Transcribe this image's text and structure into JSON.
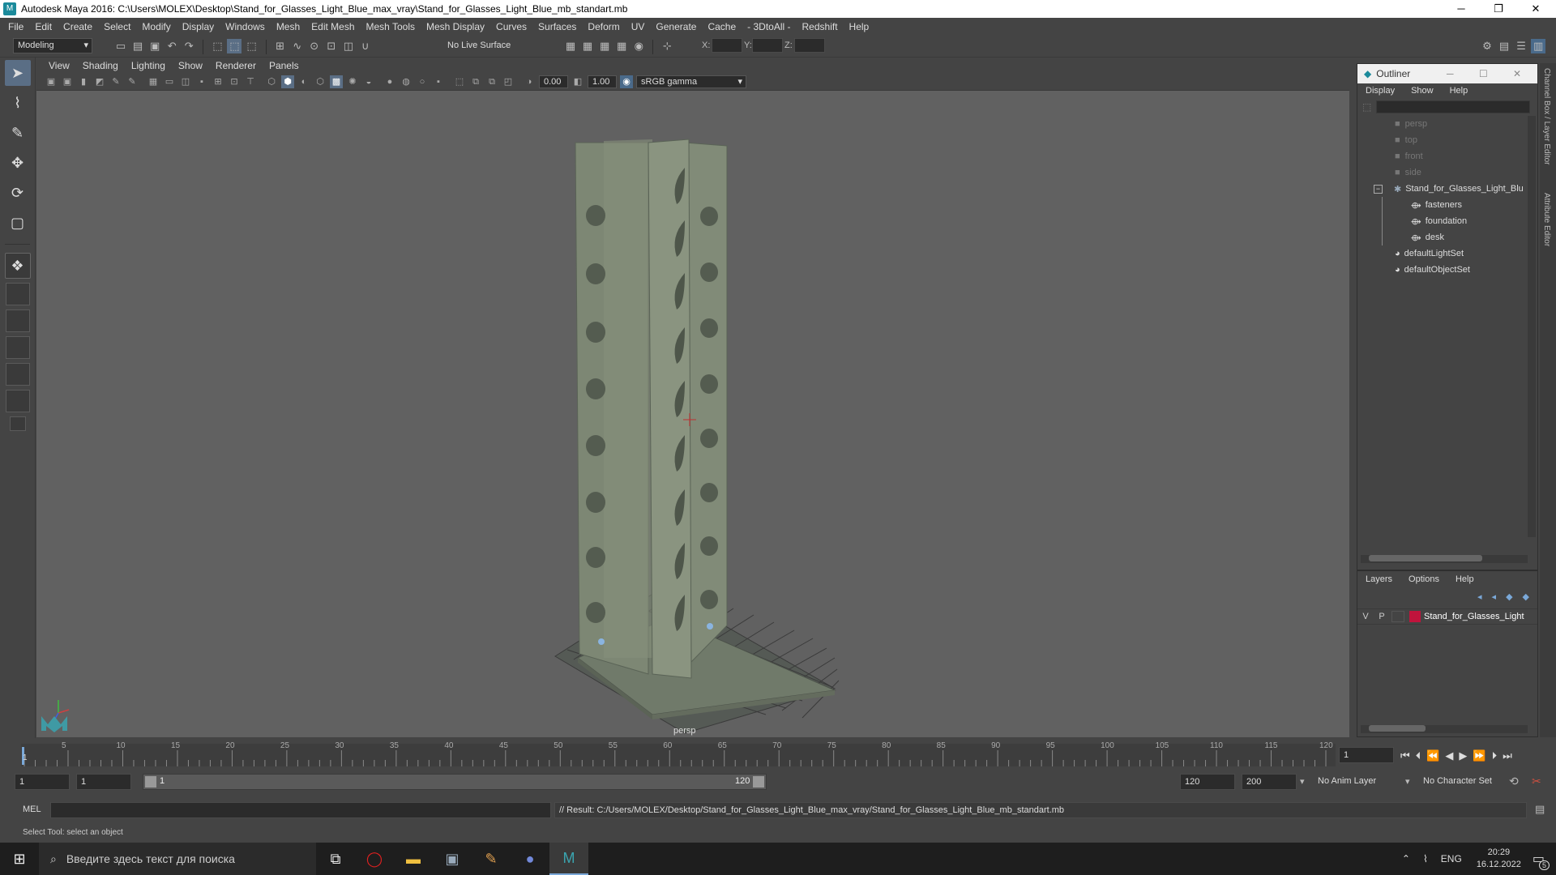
{
  "window": {
    "title": "Autodesk Maya 2016: C:\\Users\\MOLEX\\Desktop\\Stand_for_Glasses_Light_Blue_max_vray\\Stand_for_Glasses_Light_Blue_mb_standart.mb"
  },
  "menubar": [
    "File",
    "Edit",
    "Create",
    "Select",
    "Modify",
    "Display",
    "Windows",
    "Mesh",
    "Edit Mesh",
    "Mesh Tools",
    "Mesh Display",
    "Curves",
    "Surfaces",
    "Deform",
    "UV",
    "Generate",
    "Cache",
    "- 3DtoAll -",
    "Redshift",
    "Help"
  ],
  "shelf": {
    "mode": "Modeling",
    "live_surface": "No Live Surface",
    "x_label": "X:",
    "y_label": "Y:",
    "z_label": "Z:"
  },
  "viewport": {
    "menu": [
      "View",
      "Shading",
      "Lighting",
      "Show",
      "Renderer",
      "Panels"
    ],
    "exposure": "0.00",
    "gamma": "1.00",
    "color_space": "sRGB gamma",
    "camera_label": "persp"
  },
  "outliner": {
    "title": "Outliner",
    "menu": [
      "Display",
      "Show",
      "Help"
    ],
    "items": [
      {
        "label": "persp",
        "kind": "camera"
      },
      {
        "label": "top",
        "kind": "camera"
      },
      {
        "label": "front",
        "kind": "camera"
      },
      {
        "label": "side",
        "kind": "camera"
      },
      {
        "label": "Stand_for_Glasses_Light_Blu",
        "kind": "group"
      },
      {
        "label": "fasteners",
        "kind": "mesh"
      },
      {
        "label": "foundation",
        "kind": "mesh"
      },
      {
        "label": "desk",
        "kind": "mesh"
      },
      {
        "label": "defaultLightSet",
        "kind": "set"
      },
      {
        "label": "defaultObjectSet",
        "kind": "set"
      }
    ]
  },
  "layers": {
    "menu": [
      "Layers",
      "Options",
      "Help"
    ],
    "row": {
      "v": "V",
      "p": "P",
      "name": "Stand_for_Glasses_Light",
      "color": "#c0143c"
    }
  },
  "side_tabs": {
    "channel_box": "Channel Box / Layer Editor",
    "attribute_editor": "Attribute Editor"
  },
  "timeline": {
    "ticks": [
      "5",
      "10",
      "15",
      "20",
      "25",
      "30",
      "35",
      "40",
      "45",
      "50",
      "55",
      "60",
      "65",
      "70",
      "75",
      "80",
      "85",
      "90",
      "95",
      "100",
      "105",
      "110",
      "115",
      "120"
    ],
    "start_marker": "1",
    "current_frame": "1"
  },
  "range": {
    "start": "1",
    "playback_start": "1",
    "slider_start": "1",
    "slider_end": "120",
    "playback_end": "120",
    "end": "200",
    "anim_layer": "No Anim Layer",
    "character_set": "No Character Set"
  },
  "command": {
    "lang": "MEL",
    "result": "// Result: C:/Users/MOLEX/Desktop/Stand_for_Glasses_Light_Blue_max_vray/Stand_for_Glasses_Light_Blue_mb_standart.mb"
  },
  "helpline": "Select Tool: select an object",
  "taskbar": {
    "search_placeholder": "Введите здесь текст для поиска",
    "lang": "ENG",
    "time": "20:29",
    "date": "16.12.2022",
    "notif": "5"
  },
  "colors": {
    "viewport_bg": "#616161",
    "ui_bg": "#444444",
    "accent": "#5a6e85"
  }
}
